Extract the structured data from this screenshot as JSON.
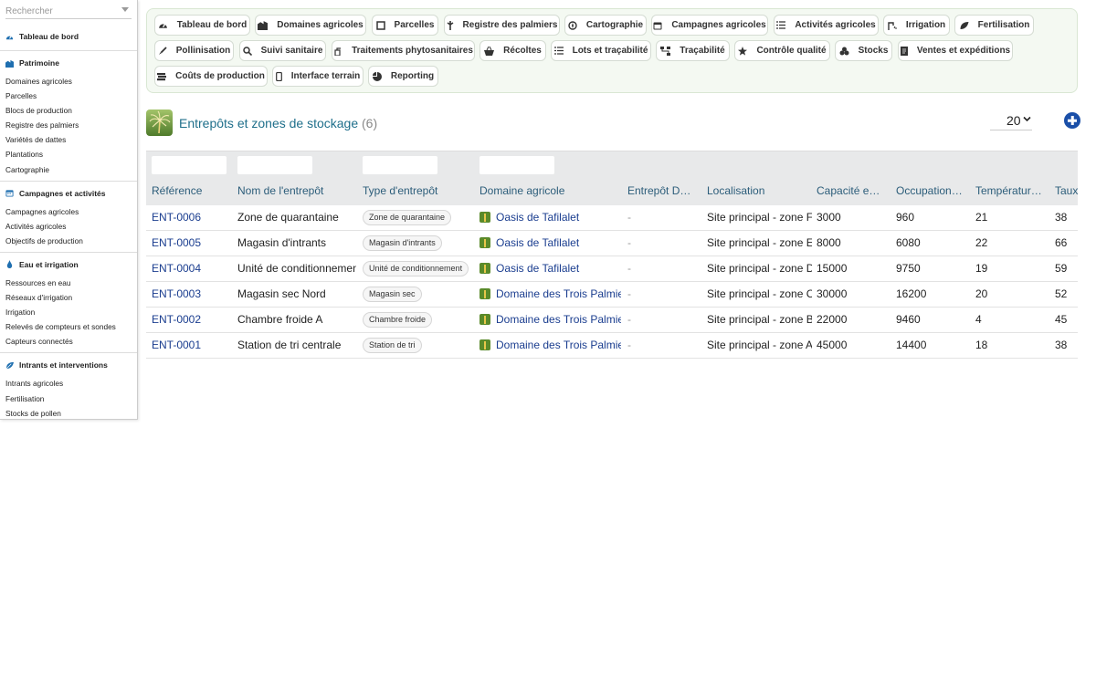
{
  "sidebar": {
    "search_placeholder": "Rechercher",
    "dashboard_label": "Tableau de bord",
    "sections": [
      {
        "title": "Patrimoine",
        "icon": "buildings-icon",
        "color": "#1f6fb0",
        "items": [
          "Domaines agricoles",
          "Parcelles",
          "Blocs de production",
          "Registre des palmiers",
          "Variétés de dattes",
          "Plantations",
          "Cartographie"
        ]
      },
      {
        "title": "Campagnes et activités",
        "icon": "calendar-icon",
        "color": "#1f6fb0",
        "items": [
          "Campagnes agricoles",
          "Activités agricoles",
          "Objectifs de production"
        ]
      },
      {
        "title": "Eau et irrigation",
        "icon": "water-drop-icon",
        "color": "#1f6fb0",
        "items": [
          "Ressources en eau",
          "Réseaux d'irrigation",
          "Irrigation",
          "Relevés de compteurs et sondes",
          "Capteurs connectés"
        ]
      },
      {
        "title": "Intrants et interventions",
        "icon": "leaf-icon",
        "color": "#1f6fb0",
        "items": [
          "Intrants agricoles",
          "Fertilisation",
          "Stocks de pollen"
        ]
      }
    ]
  },
  "nav": [
    "Tableau de bord",
    "Domaines agricoles",
    "Parcelles",
    "Registre des palmiers",
    "Cartographie",
    "Campagnes agricoles",
    "Activités agricoles",
    "Irrigation",
    "Fertilisation",
    "Pollinisation",
    "Suivi sanitaire",
    "Traitements phytosanitaires",
    "Récoltes",
    "Lots et traçabilité",
    "Traçabilité",
    "Contrôle qualité",
    "Stocks",
    "Ventes et expéditions",
    "Coûts de production",
    "Interface terrain",
    "Reporting"
  ],
  "page": {
    "title": "Entrepôts et zones de stockage",
    "count": "(6)",
    "page_size": "20"
  },
  "table": {
    "columns": [
      "Référence",
      "Nom de l'entrepôt",
      "Type d'entrepôt",
      "Domaine agricole",
      "Entrepôt Dolibarr",
      "Localisation",
      "Capacité en kg",
      "Occupation actuelle",
      "Température cible",
      "Taux"
    ],
    "rows": [
      {
        "ref": "ENT-0006",
        "name": "Zone de quarantaine",
        "type": "Zone de quarantaine",
        "domain": "Oasis de Tafilalet",
        "dolibarr": "-",
        "location": "Site principal - zone F",
        "capacity": "3000",
        "occupation": "960",
        "temp": "21",
        "rate": "38"
      },
      {
        "ref": "ENT-0005",
        "name": "Magasin d'intrants",
        "type": "Magasin d'intrants",
        "domain": "Oasis de Tafilalet",
        "dolibarr": "-",
        "location": "Site principal - zone E",
        "capacity": "8000",
        "occupation": "6080",
        "temp": "22",
        "rate": "66"
      },
      {
        "ref": "ENT-0004",
        "name": "Unité de conditionnement",
        "type": "Unité de conditionnement",
        "domain": "Oasis de Tafilalet",
        "dolibarr": "-",
        "location": "Site principal - zone D",
        "capacity": "15000",
        "occupation": "9750",
        "temp": "19",
        "rate": "59"
      },
      {
        "ref": "ENT-0003",
        "name": "Magasin sec Nord",
        "type": "Magasin sec",
        "domain": "Domaine des Trois Palmiers",
        "dolibarr": "-",
        "location": "Site principal - zone C",
        "capacity": "30000",
        "occupation": "16200",
        "temp": "20",
        "rate": "52"
      },
      {
        "ref": "ENT-0002",
        "name": "Chambre froide A",
        "type": "Chambre froide",
        "domain": "Domaine des Trois Palmiers",
        "dolibarr": "-",
        "location": "Site principal - zone B",
        "capacity": "22000",
        "occupation": "9460",
        "temp": "4",
        "rate": "45"
      },
      {
        "ref": "ENT-0001",
        "name": "Station de tri centrale",
        "type": "Station de tri",
        "domain": "Domaine des Trois Palmiers",
        "dolibarr": "-",
        "location": "Site principal - zone A",
        "capacity": "45000",
        "occupation": "14400",
        "temp": "18",
        "rate": "38"
      }
    ]
  }
}
